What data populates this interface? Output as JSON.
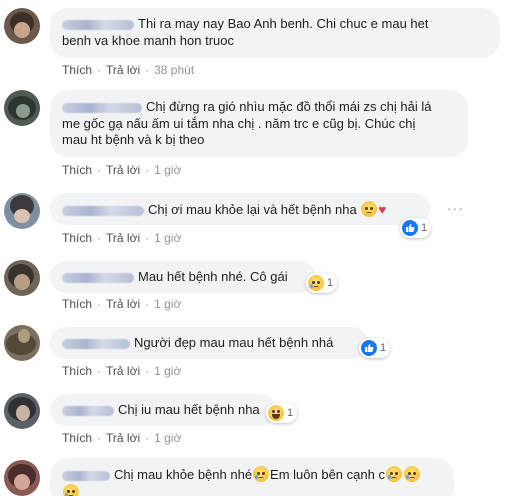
{
  "actions": {
    "like": "Thích",
    "reply": "Trả lời"
  },
  "comments": [
    {
      "text_line1": "Thi ra may nay Bao Anh benh. Chi chuc e mau het",
      "text_line2": "benh va khoe manh hon truoc",
      "time": "38 phút"
    },
    {
      "text_line1": "Chị đừng ra gió nhìu mặc đồ thổi mái zs chị hải lá",
      "text_line2": "me gốc gạ nấu ấm ui tắm nha chị . năm trc e cũg bị. Chúc chị",
      "text_line3": "mau ht bệnh và k bị theo",
      "time": "1 giờ"
    },
    {
      "text": "Chị ơi mau khỏe lại và hết bệnh nha",
      "time": "1 giờ",
      "reaction_count": "1",
      "more": "···"
    },
    {
      "text": "Mau hết bệnh nhé. Cô gái",
      "time": "1 giờ",
      "reaction_count": "1"
    },
    {
      "text": "Người đẹp mau mau hết bệnh nhá",
      "time": "1 giờ",
      "reaction_count": "1"
    },
    {
      "text": "Chị iu mau hết bệnh nha",
      "time": "1 giờ",
      "reaction_count": "1"
    },
    {
      "text_a": "Chị mau khỏe bệnh nhé",
      "text_b": "Em luôn bên cạnh c"
    }
  ],
  "colors": {
    "bubble": "#f2f3f5",
    "like_blue": "#1877f2",
    "meta": "#90949c"
  }
}
